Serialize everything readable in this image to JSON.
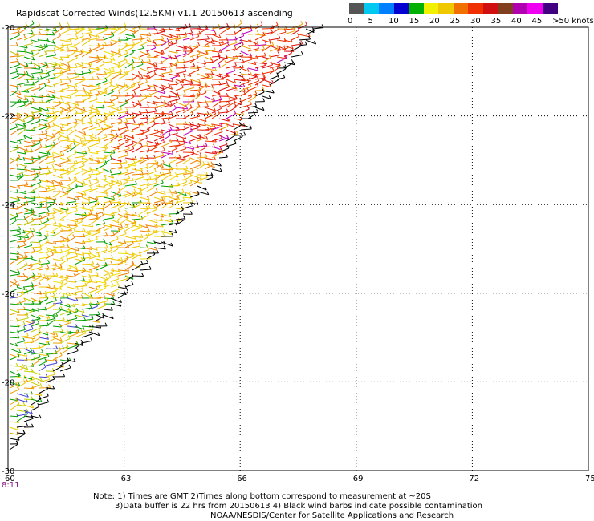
{
  "title": "Rapidscat Corrected Winds(12.5KM) v1.1 20150613 ascending",
  "colorbar": {
    "colors": [
      "#555555",
      "#00c8f0",
      "#0080ff",
      "#0000d0",
      "#00b000",
      "#f0f000",
      "#f0c800",
      "#f07000",
      "#f03000",
      "#d01010",
      "#804020",
      "#b000b0",
      "#f000f0",
      "#400080"
    ],
    "labels": [
      {
        "text": "0",
        "at": 0
      },
      {
        "text": "5",
        "at": 1
      },
      {
        "text": "10",
        "at": 2
      },
      {
        "text": "15",
        "at": 3
      },
      {
        "text": "20",
        "at": 4
      },
      {
        "text": "25",
        "at": 5
      },
      {
        "text": "30",
        "at": 6
      },
      {
        "text": "35",
        "at": 7
      },
      {
        "text": "40",
        "at": 8
      },
      {
        "text": "45",
        "at": 9
      },
      {
        "text": ">50 knots",
        "at": 10
      }
    ]
  },
  "axes": {
    "lon_ticks": [
      "60",
      "63",
      "66",
      "69",
      "72",
      "75"
    ],
    "lat_ticks": [
      "-20",
      "-22",
      "-24",
      "-26",
      "-28",
      "-30"
    ],
    "lon_range": [
      60,
      75
    ],
    "lat_range": [
      -30,
      -20
    ]
  },
  "swath_edge_lon_at_lat": [
    [
      -20,
      68.0
    ],
    [
      -22,
      66.3
    ],
    [
      -24,
      64.8
    ],
    [
      -26,
      63.0
    ],
    [
      -28,
      61.2
    ],
    [
      -29.7,
      60.0
    ]
  ],
  "time_label": "8:11",
  "notes": [
    "Note: 1) Times are GMT 2)Times along bottom correspond to measurement at ~20S",
    "3)Data buffer is 22 hrs from 20150613 4) Black wind barbs indicate possible contamination",
    "NOAA/NESDIS/Center for Satellite Applications and Research"
  ]
}
